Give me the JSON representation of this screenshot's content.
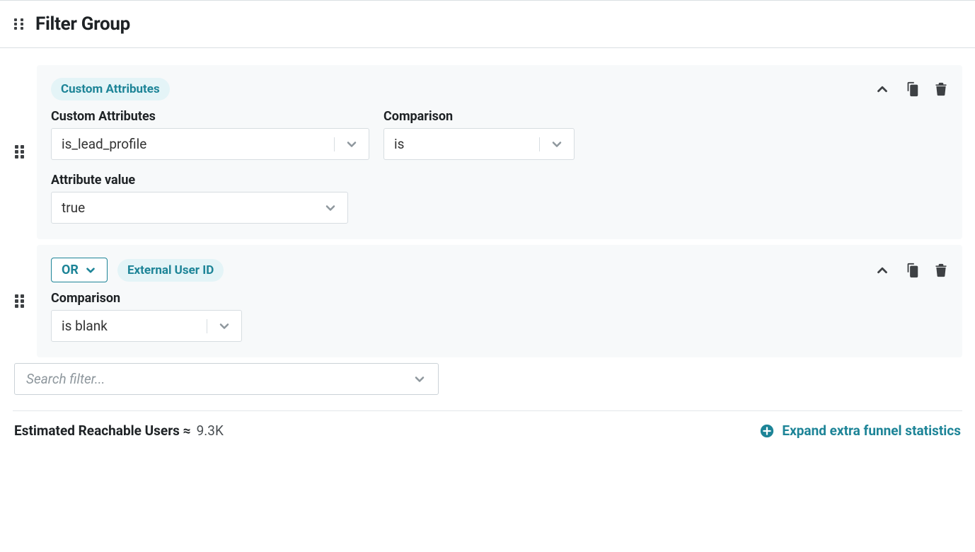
{
  "header": {
    "title": "Filter Group"
  },
  "filters": [
    {
      "badge": "Custom Attributes",
      "fields": {
        "custom_attributes": {
          "label": "Custom Attributes",
          "value": "is_lead_profile"
        },
        "comparison": {
          "label": "Comparison",
          "value": "is"
        },
        "attribute_value": {
          "label": "Attribute value",
          "value": "true"
        }
      }
    },
    {
      "logic": "OR",
      "badge": "External User ID",
      "fields": {
        "comparison": {
          "label": "Comparison",
          "value": "is blank"
        }
      }
    }
  ],
  "search": {
    "placeholder": "Search filter..."
  },
  "footer": {
    "estimated_label": "Estimated Reachable Users ≈",
    "estimated_value": "9.3K",
    "expand_label": "Expand extra funnel statistics"
  }
}
